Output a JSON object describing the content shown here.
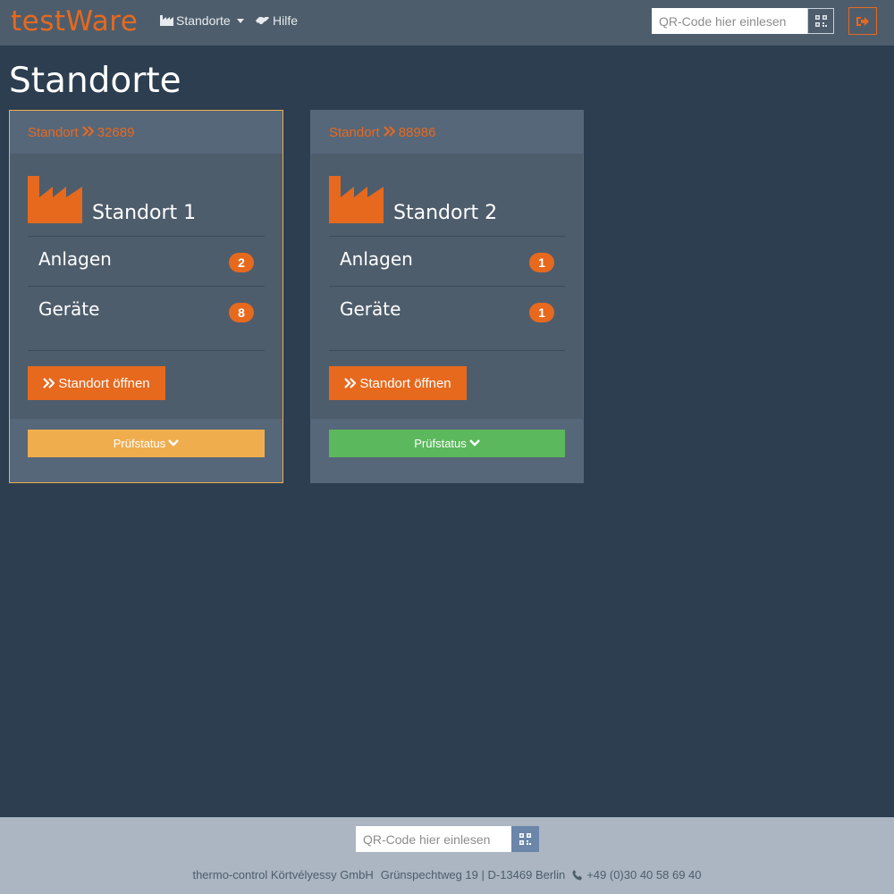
{
  "navbar": {
    "brand": "testWare",
    "menu_standorte": "Standorte",
    "menu_hilfe": "Hilfe",
    "qr_placeholder": "QR-Code hier einlesen",
    "icons": {
      "standorte": "industry-icon",
      "hilfe": "handshake-icon",
      "qr": "qrcode-icon",
      "logout": "sign-out-icon"
    }
  },
  "page": {
    "title": "Standorte"
  },
  "cards": [
    {
      "header_label": "Standort",
      "header_number": "32689",
      "name": "Standort 1",
      "anlagen_label": "Anlagen",
      "anlagen_count": "2",
      "geraete_label": "Geräte",
      "geraete_count": "8",
      "open_label": "Standort öffnen",
      "status_label": "Prüfstatus",
      "status_color": "#f0ad4e",
      "border_color": "#f0ad4e"
    },
    {
      "header_label": "Standort",
      "header_number": "88986",
      "name": "Standort 2",
      "anlagen_label": "Anlagen",
      "anlagen_count": "1",
      "geraete_label": "Geräte",
      "geraete_count": "1",
      "open_label": "Standort öffnen",
      "status_label": "Prüfstatus",
      "status_color": "#5cb85c"
    }
  ],
  "footer": {
    "qr_placeholder": "QR-Code hier einlesen",
    "company": "thermo-control Körtvélyessy GmbH",
    "address": "Grünspechtweg 19 | D-13469 Berlin",
    "phone": "+49 (0)30 40 58 69 40"
  },
  "colors": {
    "accent": "#e6691e",
    "background": "#2c3e50",
    "panel": "#4e5d6c",
    "footer": "#abb6c2"
  }
}
